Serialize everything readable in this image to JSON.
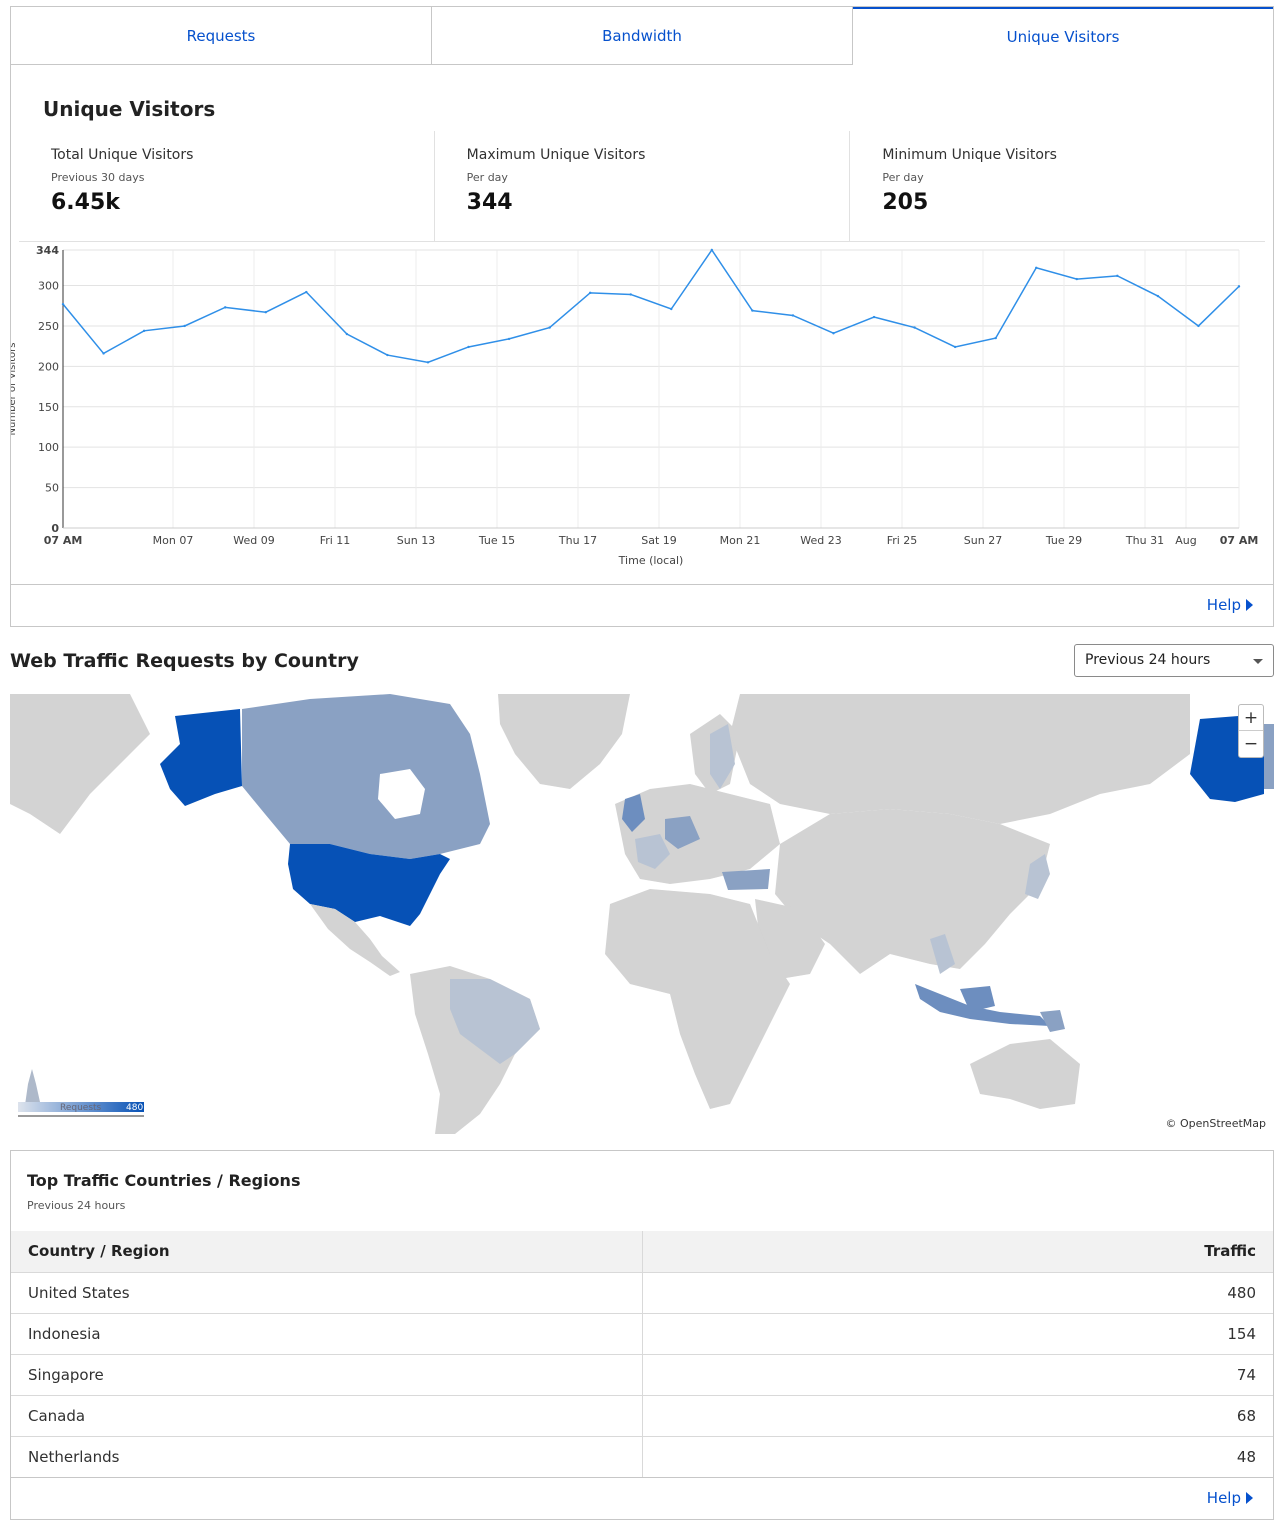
{
  "tabs": [
    {
      "label": "Requests"
    },
    {
      "label": "Bandwidth"
    },
    {
      "label": "Unique Visitors"
    }
  ],
  "active_tab": "Unique Visitors",
  "section_title": "Unique Visitors",
  "stats": [
    {
      "label": "Total Unique Visitors",
      "sub": "Previous 30 days",
      "value": "6.45k"
    },
    {
      "label": "Maximum Unique Visitors",
      "sub": "Per day",
      "value": "344"
    },
    {
      "label": "Minimum Unique Visitors",
      "sub": "Per day",
      "value": "205"
    }
  ],
  "colors": {
    "accent": "#0651cd",
    "line": "#2f8fe8",
    "map_high": "#0651b6",
    "map_low": "#b8c3d3",
    "land": "#d3d3d3"
  },
  "chart_data": {
    "type": "line",
    "title": "",
    "xlabel": "Time (local)",
    "ylabel": "Number of Visitors",
    "ylim": [
      0,
      344
    ],
    "yticks": [
      "0",
      "50",
      "100",
      "150",
      "200",
      "250",
      "300",
      "344"
    ],
    "xticks": [
      "07 AM",
      "Mon 07",
      "Wed 09",
      "Fri 11",
      "Sun 13",
      "Tue 15",
      "Thu 17",
      "Sat 19",
      "Mon 21",
      "Wed 23",
      "Fri 25",
      "Sun 27",
      "Tue 29",
      "Thu 31",
      "Aug",
      "07 AM"
    ],
    "grid": true,
    "series": [
      {
        "values": [
          277,
          216,
          244,
          250,
          273,
          267,
          292,
          240,
          214,
          205,
          224,
          234,
          248,
          291,
          289,
          271,
          344,
          269,
          263,
          241,
          261,
          248,
          224,
          235,
          322,
          308,
          312,
          287,
          250,
          299
        ]
      }
    ]
  },
  "help_label": "Help",
  "map": {
    "title": "Web Traffic Requests by Country",
    "range": "Previous 24 hours",
    "zoom_in": "+",
    "zoom_out": "−",
    "attribution": "© OpenStreetMap",
    "legend_label": "Requests",
    "legend_max": "480"
  },
  "top_table": {
    "title": "Top Traffic Countries / Regions",
    "sub": "Previous 24 hours",
    "headers": [
      "Country / Region",
      "Traffic"
    ],
    "rows": [
      {
        "country": "United States",
        "traffic": "480"
      },
      {
        "country": "Indonesia",
        "traffic": "154"
      },
      {
        "country": "Singapore",
        "traffic": "74"
      },
      {
        "country": "Canada",
        "traffic": "68"
      },
      {
        "country": "Netherlands",
        "traffic": "48"
      }
    ]
  }
}
